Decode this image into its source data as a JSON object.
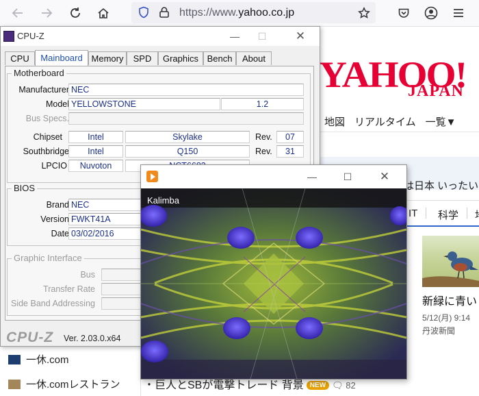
{
  "browser": {
    "url_prefix": "https://www.",
    "url_host": "yahoo.co.jp"
  },
  "yahoo": {
    "logo": "YAHOO!",
    "logo_sub": "JAPAN",
    "nav": [
      "地図",
      "リアルタイム",
      "一覧▼"
    ],
    "topic_text": "は日本 いったい",
    "categories": [
      "IT",
      "科学",
      "地"
    ],
    "news_title": "新緑に青い",
    "news_date": "5/12(月) 9:14",
    "news_source": "丹波新聞",
    "side_items": [
      "一休.com",
      "一休.comレストラン"
    ],
    "headline": "・巨人とSBが電撃トレード 背景",
    "headline_badge": "NEW",
    "headline_comments": "82"
  },
  "cpuz": {
    "title": "CPU-Z",
    "tabs": [
      "CPU",
      "Mainboard",
      "Memory",
      "SPD",
      "Graphics",
      "Bench",
      "About"
    ],
    "active_tab": "Mainboard",
    "motherboard": {
      "legend": "Motherboard",
      "manufacturer_label": "Manufacturer",
      "manufacturer": "NEC",
      "model_label": "Model",
      "model": "YELLOWSTONE",
      "model_rev": "1.2",
      "bus_specs_label": "Bus Specs.",
      "chipset_label": "Chipset",
      "chipset_vendor": "Intel",
      "chipset_name": "Skylake",
      "chipset_rev_label": "Rev.",
      "chipset_rev": "07",
      "southbridge_label": "Southbridge",
      "southbridge_vendor": "Intel",
      "southbridge_name": "Q150",
      "southbridge_rev_label": "Rev.",
      "southbridge_rev": "31",
      "lpcio_label": "LPCIO",
      "lpcio_vendor": "Nuvoton",
      "lpcio_name": "NCT6683"
    },
    "bios": {
      "legend": "BIOS",
      "brand_label": "Brand",
      "brand": "NEC",
      "version_label": "Version",
      "version": "FWKT41A",
      "date_label": "Date",
      "date": "03/02/2016"
    },
    "graphic": {
      "legend": "Graphic Interface",
      "bus_label": "Bus",
      "transfer_rate_label": "Transfer Rate",
      "side_band_label": "Side Band Addressing"
    },
    "footer_logo": "CPU-Z",
    "version": "Ver. 2.03.0.x64"
  },
  "player": {
    "track": "Kalimba"
  },
  "colors": {
    "yahoo_red": "#e60033",
    "cpuz_value_text": "#1a2f8c",
    "active_tab_text": "#1f4fb0"
  }
}
